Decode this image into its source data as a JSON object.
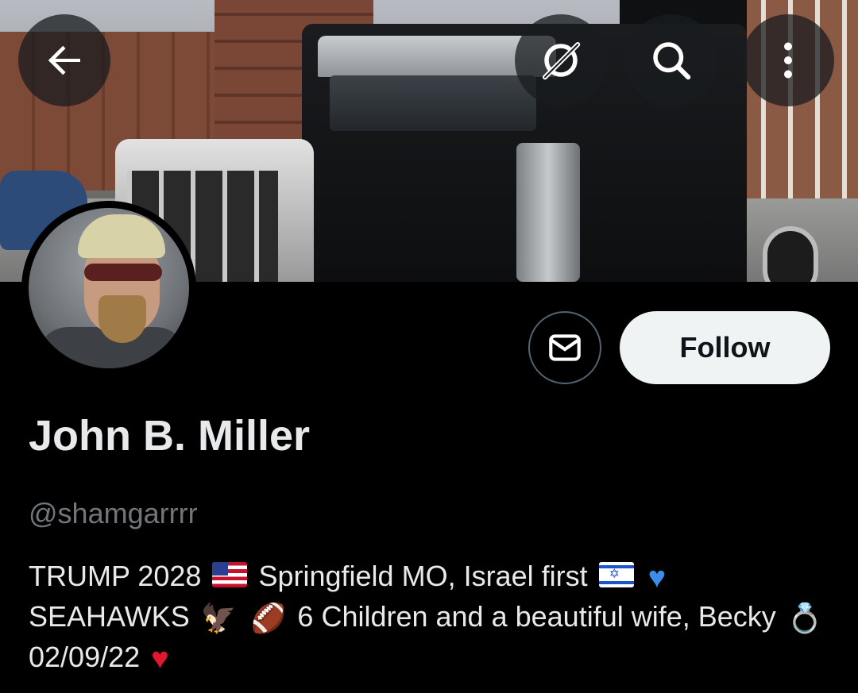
{
  "profile": {
    "display_name": "John B. Miller",
    "handle": "@shamgarrrr",
    "bio": {
      "line1_a": "TRUMP 2028",
      "line1_b": "Springfield MO, Israel first",
      "line2_a": "SEAHAWKS",
      "line2_b": "6 Children and a beautiful wife, Becky",
      "line3": "02/09/22"
    }
  },
  "actions": {
    "follow_label": "Follow"
  },
  "icons": {
    "back": "arrow-left-icon",
    "grok": "grok-icon",
    "search": "search-icon",
    "more": "more-vertical-icon",
    "message": "envelope-icon"
  },
  "colors": {
    "background": "#000000",
    "text": "#e7e9ea",
    "handle": "#71767b",
    "follow_bg": "#eff3f4",
    "follow_text": "#0f1419",
    "outline": "#536471"
  }
}
